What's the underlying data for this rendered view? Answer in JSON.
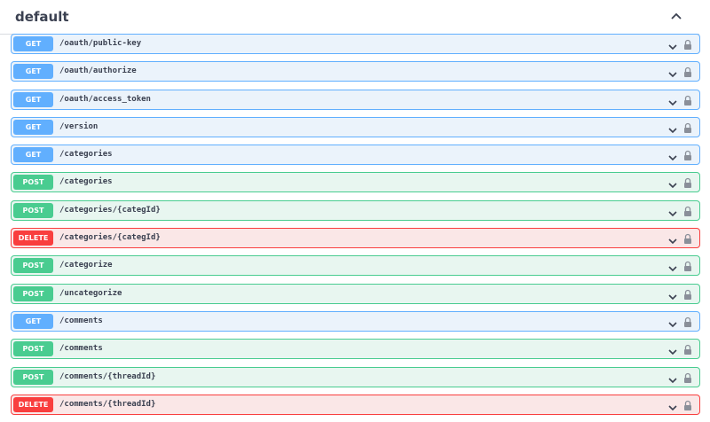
{
  "section": {
    "title": "default"
  },
  "operations": [
    {
      "method": "GET",
      "path": "/oauth/public-key"
    },
    {
      "method": "GET",
      "path": "/oauth/authorize"
    },
    {
      "method": "GET",
      "path": "/oauth/access_token"
    },
    {
      "method": "GET",
      "path": "/version"
    },
    {
      "method": "GET",
      "path": "/categories"
    },
    {
      "method": "POST",
      "path": "/categories"
    },
    {
      "method": "POST",
      "path": "/categories/{categId}"
    },
    {
      "method": "DELETE",
      "path": "/categories/{categId}"
    },
    {
      "method": "POST",
      "path": "/categorize"
    },
    {
      "method": "POST",
      "path": "/uncategorize"
    },
    {
      "method": "GET",
      "path": "/comments"
    },
    {
      "method": "POST",
      "path": "/comments"
    },
    {
      "method": "POST",
      "path": "/comments/{threadId}"
    },
    {
      "method": "DELETE",
      "path": "/comments/{threadId}"
    }
  ],
  "colors": {
    "get": "#61affe",
    "post": "#49cc90",
    "delete": "#f93e3e"
  },
  "icons": {
    "expand": "chevron-down-icon",
    "collapse": "chevron-up-icon",
    "auth": "lock-icon"
  }
}
